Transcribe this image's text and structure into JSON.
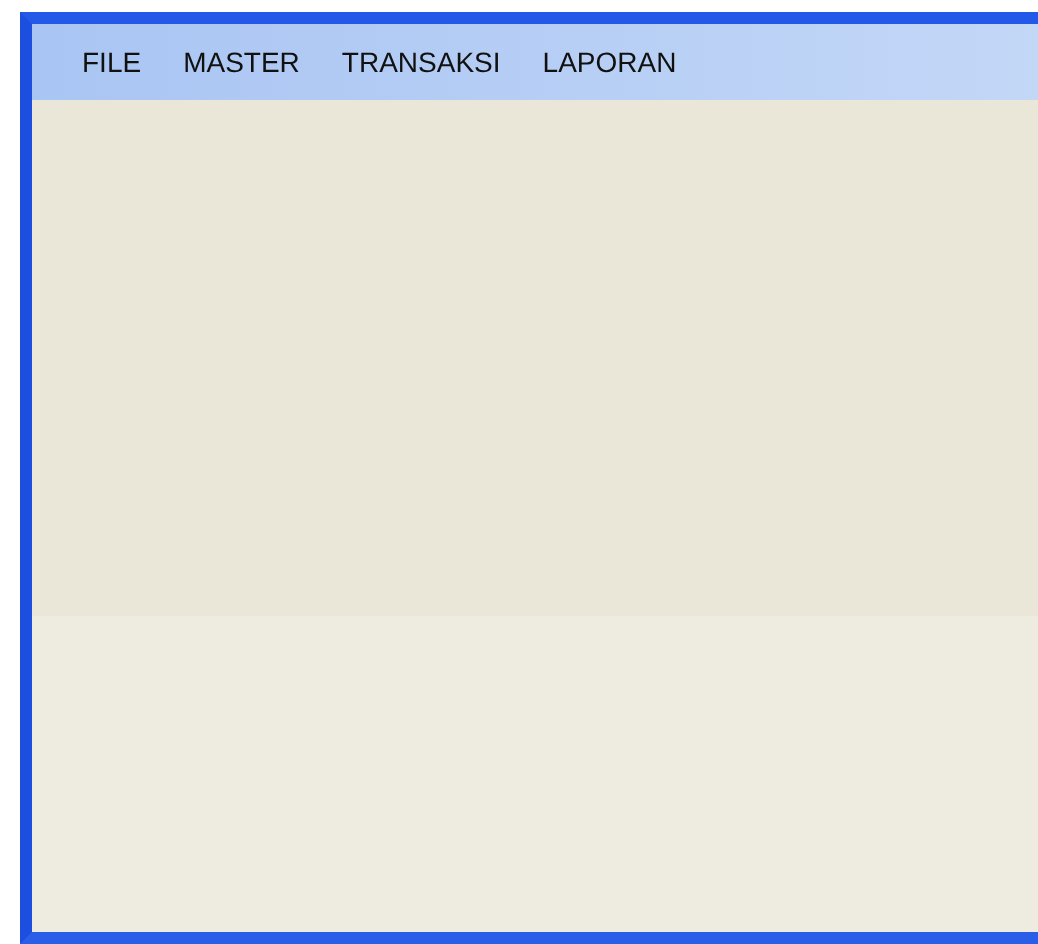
{
  "menu_bar": {
    "items": [
      {
        "label": "FILE"
      },
      {
        "label": "MASTER"
      },
      {
        "label": "TRANSAKSI"
      },
      {
        "label": "LAPORAN"
      }
    ]
  }
}
